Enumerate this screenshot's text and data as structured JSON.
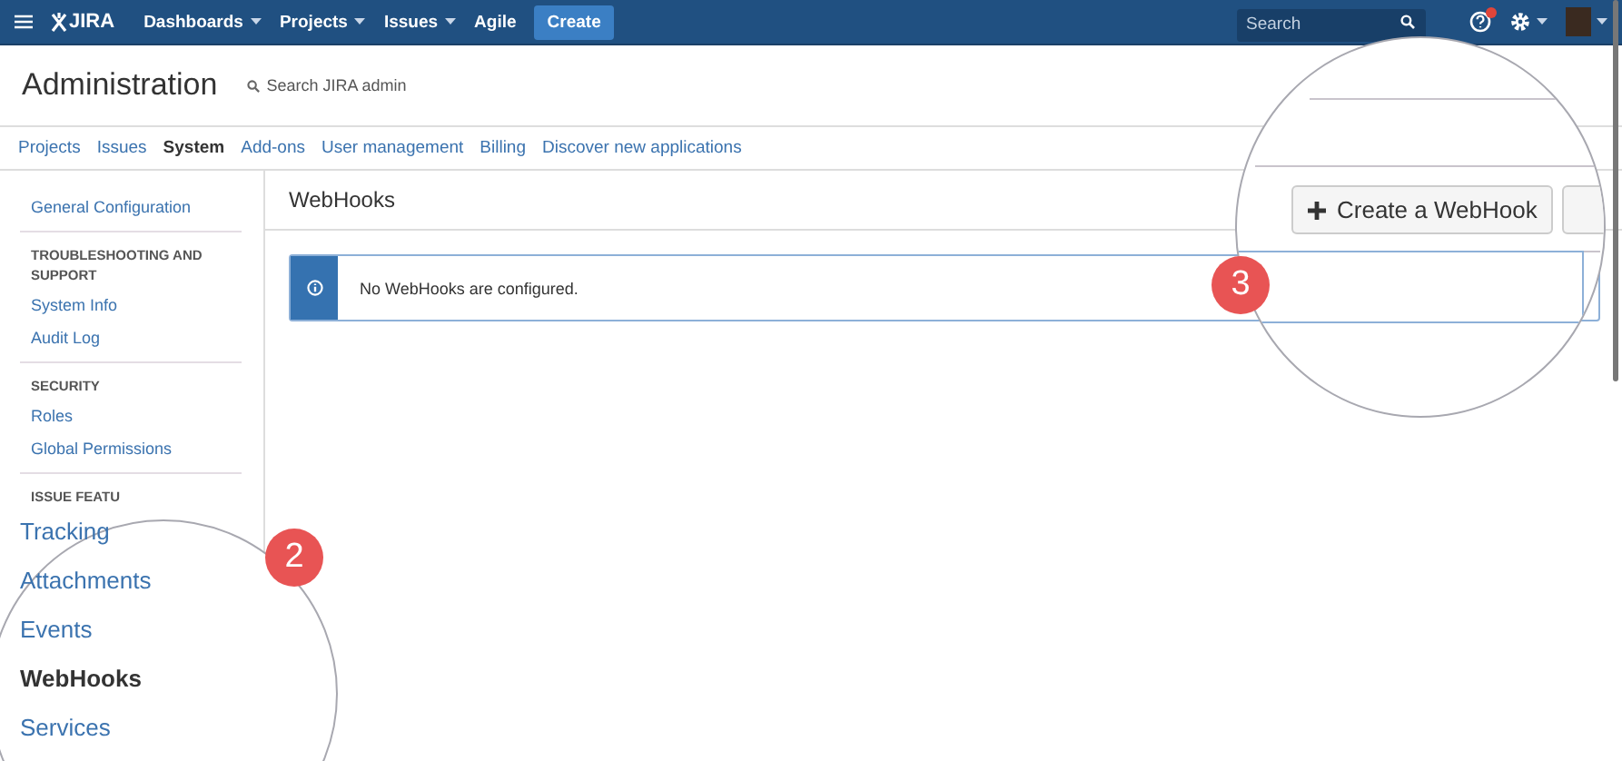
{
  "nav": {
    "logo": "JIRA",
    "menus": [
      {
        "label": "Dashboards",
        "dropdown": true
      },
      {
        "label": "Projects",
        "dropdown": true
      },
      {
        "label": "Issues",
        "dropdown": true
      },
      {
        "label": "Agile",
        "dropdown": false
      }
    ],
    "create": "Create",
    "search": {
      "placeholder": "Search"
    },
    "help_notification": true
  },
  "header": {
    "title": "Administration",
    "search": "Search JIRA admin"
  },
  "tabs": [
    {
      "label": "Projects",
      "selected": false
    },
    {
      "label": "Issues",
      "selected": false
    },
    {
      "label": "System",
      "selected": true
    },
    {
      "label": "Add-ons",
      "selected": false
    },
    {
      "label": "User management",
      "selected": false
    },
    {
      "label": "Billing",
      "selected": false
    },
    {
      "label": "Discover new applications",
      "selected": false
    }
  ],
  "sidebar": {
    "items": [
      {
        "kind": "link",
        "label": "General Configuration"
      },
      {
        "kind": "divider"
      },
      {
        "kind": "heading",
        "label": "TROUBLESHOOTING AND SUPPORT"
      },
      {
        "kind": "link",
        "label": "System Info"
      },
      {
        "kind": "link",
        "label": "Audit Log"
      },
      {
        "kind": "divider"
      },
      {
        "kind": "heading",
        "label": "SECURITY"
      },
      {
        "kind": "link",
        "label": "Roles"
      },
      {
        "kind": "link",
        "label": "Global Permissions"
      },
      {
        "kind": "divider"
      },
      {
        "kind": "heading",
        "label": "ISSUE FEATU"
      }
    ]
  },
  "content": {
    "title": "WebHooks",
    "message": "No WebHooks are configured."
  },
  "magnifier_left": {
    "badge": "2",
    "items": [
      {
        "label": "Tracking",
        "selected": false
      },
      {
        "label": "Attachments",
        "selected": false
      },
      {
        "label": "Events",
        "selected": false
      },
      {
        "label": "WebHooks",
        "selected": true
      },
      {
        "label": "Services",
        "selected": false
      }
    ]
  },
  "magnifier_right": {
    "badge": "3",
    "button": "Create a WebHook"
  }
}
